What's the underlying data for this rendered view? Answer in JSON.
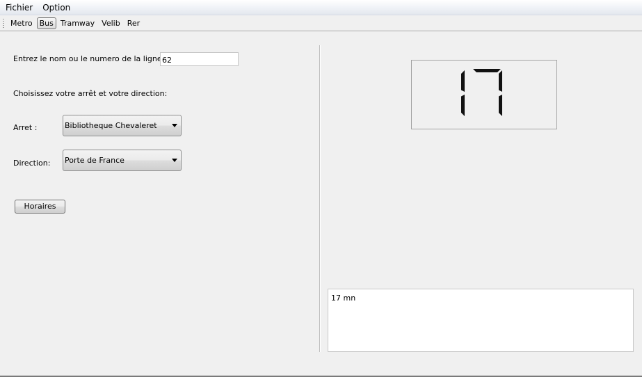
{
  "menubar": {
    "items": [
      "Fichier",
      "Option"
    ]
  },
  "toolbar": {
    "tabs": [
      "Metro",
      "Bus",
      "Tramway",
      "Velib",
      "Rer"
    ],
    "active": "Bus"
  },
  "form": {
    "line_label": "Entrez le nom ou le numero de la ligne :",
    "line_value": "62",
    "instruction": "Choisissez votre arrêt et votre direction:",
    "stop_label": "Arret :",
    "stop_value": "Bibliotheque Chevaleret",
    "direction_label": "Direction:",
    "direction_value": "Porte de France",
    "schedule_button": "Horaires"
  },
  "display": {
    "digits": "17"
  },
  "output": {
    "text": "17 mn"
  }
}
